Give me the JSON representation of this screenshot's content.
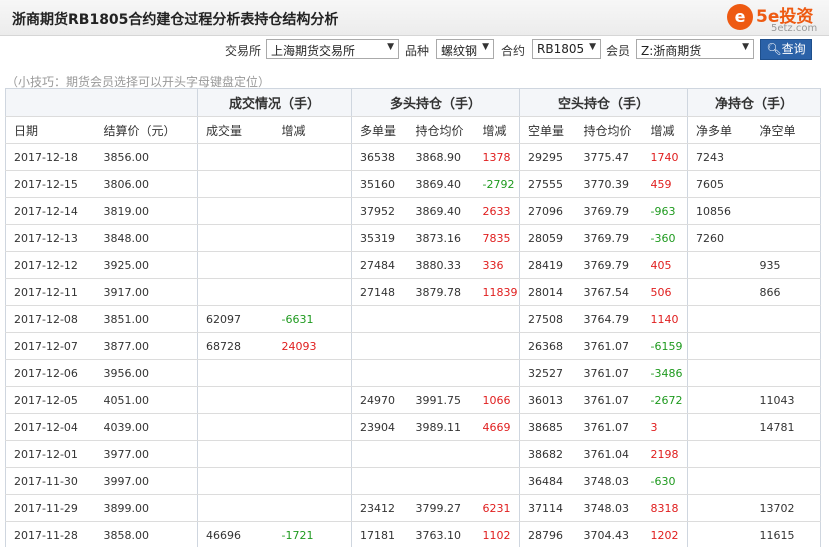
{
  "page": {
    "title": "浙商期货RB1805合约建仓过程分析表持仓结构分析"
  },
  "logo": {
    "mark": "e",
    "brand": "5e投资",
    "domain": "5etz.com"
  },
  "filters": {
    "exchange_label": "交易所",
    "exchange_value": "上海期货交易所",
    "variety_label": "品种",
    "variety_value": "螺纹钢",
    "contract_label": "合约",
    "contract_value": "RB1805",
    "member_label": "会员",
    "member_value": "Z:浙商期货",
    "search_label": "查询"
  },
  "tip": "（小技巧：期货会员选择可以开头字母键盘定位）",
  "table": {
    "groups": [
      "成交情况（手）",
      "多头持仓（手）",
      "空头持仓（手）",
      "净持仓（手）"
    ],
    "columns": [
      "日期",
      "结算价（元）",
      "成交量",
      "增减",
      "多单量",
      "持仓均价",
      "增减",
      "空单量",
      "持仓均价",
      "增减",
      "净多单",
      "净空单"
    ],
    "rows": [
      [
        "2017-12-18",
        "3856.00",
        "",
        "",
        "36538",
        "3868.90",
        "1378",
        "29295",
        "3775.47",
        "1740",
        "7243",
        ""
      ],
      [
        "2017-12-15",
        "3806.00",
        "",
        "",
        "35160",
        "3869.40",
        "-2792",
        "27555",
        "3770.39",
        "459",
        "7605",
        ""
      ],
      [
        "2017-12-14",
        "3819.00",
        "",
        "",
        "37952",
        "3869.40",
        "2633",
        "27096",
        "3769.79",
        "-963",
        "10856",
        ""
      ],
      [
        "2017-12-13",
        "3848.00",
        "",
        "",
        "35319",
        "3873.16",
        "7835",
        "28059",
        "3769.79",
        "-360",
        "7260",
        ""
      ],
      [
        "2017-12-12",
        "3925.00",
        "",
        "",
        "27484",
        "3880.33",
        "336",
        "28419",
        "3769.79",
        "405",
        "",
        "935"
      ],
      [
        "2017-12-11",
        "3917.00",
        "",
        "",
        "27148",
        "3879.78",
        "11839",
        "28014",
        "3767.54",
        "506",
        "",
        "866"
      ],
      [
        "2017-12-08",
        "3851.00",
        "62097",
        "-6631",
        "",
        "",
        "",
        "27508",
        "3764.79",
        "1140",
        "",
        ""
      ],
      [
        "2017-12-07",
        "3877.00",
        "68728",
        "24093",
        "",
        "",
        "",
        "26368",
        "3761.07",
        "-6159",
        "",
        ""
      ],
      [
        "2017-12-06",
        "3956.00",
        "",
        "",
        "",
        "",
        "",
        "32527",
        "3761.07",
        "-3486",
        "",
        ""
      ],
      [
        "2017-12-05",
        "4051.00",
        "",
        "",
        "24970",
        "3991.75",
        "1066",
        "36013",
        "3761.07",
        "-2672",
        "",
        "11043"
      ],
      [
        "2017-12-04",
        "4039.00",
        "",
        "",
        "23904",
        "3989.11",
        "4669",
        "38685",
        "3761.07",
        "3",
        "",
        "14781"
      ],
      [
        "2017-12-01",
        "3977.00",
        "",
        "",
        "",
        "",
        "",
        "38682",
        "3761.04",
        "2198",
        "",
        ""
      ],
      [
        "2017-11-30",
        "3997.00",
        "",
        "",
        "",
        "",
        "",
        "36484",
        "3748.03",
        "-630",
        "",
        ""
      ],
      [
        "2017-11-29",
        "3899.00",
        "",
        "",
        "23412",
        "3799.27",
        "6231",
        "37114",
        "3748.03",
        "8318",
        "",
        "13702"
      ],
      [
        "2017-11-28",
        "3858.00",
        "46696",
        "-1721",
        "17181",
        "3763.10",
        "1102",
        "28796",
        "3704.43",
        "1202",
        "",
        "11615"
      ]
    ]
  },
  "colors": {
    "increase": "#e01e1e",
    "decrease": "#1f9a1f",
    "button": "#2b62a8",
    "logo": "#ee5a12"
  }
}
